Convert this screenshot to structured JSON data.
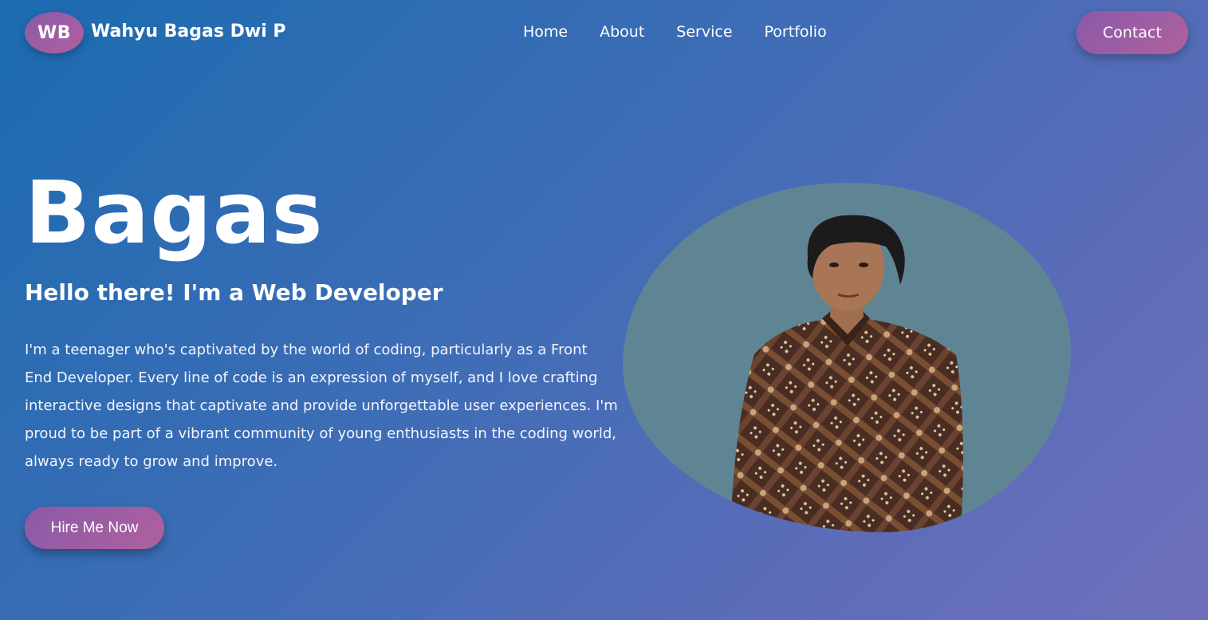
{
  "header": {
    "logo_initials": "WB",
    "brand_name": "Wahyu Bagas Dwi P",
    "nav": [
      {
        "label": "Home"
      },
      {
        "label": "About"
      },
      {
        "label": "Service"
      },
      {
        "label": "Portfolio"
      }
    ],
    "contact_label": "Contact"
  },
  "hero": {
    "name": "Bagas",
    "subtitle": "Hello there! I'm a Web Developer",
    "description": "I'm a teenager who's captivated by the world of coding, particularly as a Front End Developer. Every line of code is an expression of myself, and I love crafting interactive designs that captivate and provide unforgettable user experiences. I'm proud to be part of a vibrant community of young enthusiasts in the coding world, always ready to grow and improve.",
    "cta_label": "Hire Me Now"
  },
  "colors": {
    "accent": "#9c5da4",
    "blob": "#5f8595",
    "bg_start": "#1b6bb0",
    "bg_end": "#6f70bd"
  }
}
